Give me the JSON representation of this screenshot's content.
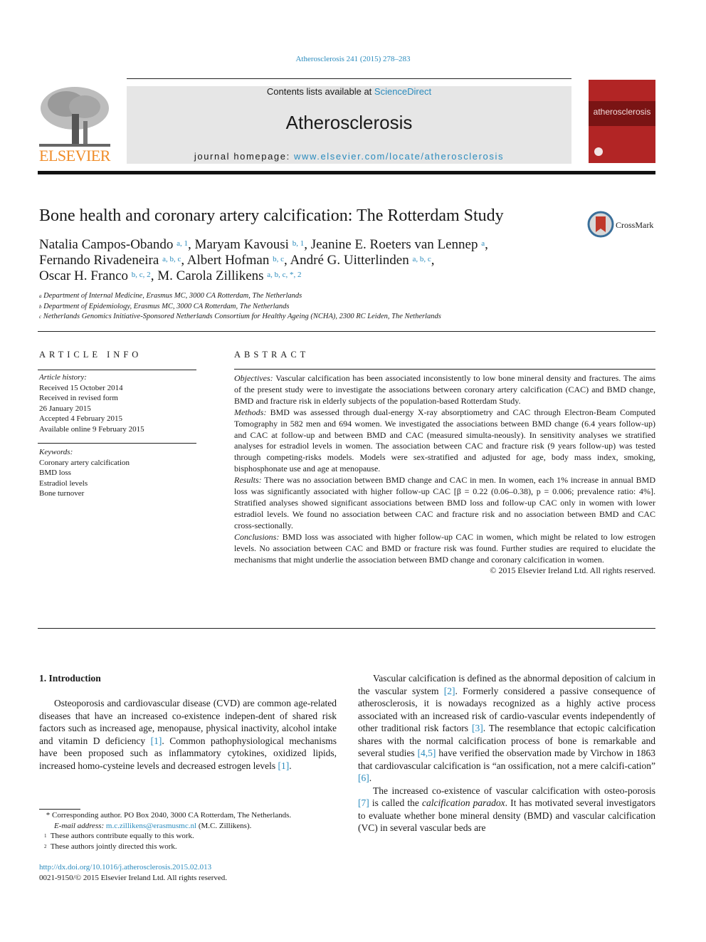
{
  "journal_ref": "Atherosclerosis 241 (2015) 278–283",
  "header": {
    "contents_prefix": "Contents lists available at ",
    "contents_link": "ScienceDirect",
    "journal_title": "Atherosclerosis",
    "homepage_prefix": "journal homepage: ",
    "homepage_link": "www.elsevier.com/locate/atherosclerosis",
    "publisher_logo": "ELSEVIER",
    "cover_title": "atherosclerosis",
    "crossmark": "CrossMark"
  },
  "colors": {
    "link": "#2a8bbd",
    "elsevier_orange": "#f08c28",
    "cover_red": "#b22525"
  },
  "article": {
    "title": "Bone health and coronary artery calcification: The Rotterdam Study",
    "authors": [
      {
        "name": "Natalia Campos-Obando",
        "sup": "a, 1",
        "sep": ", "
      },
      {
        "name": "Maryam Kavousi",
        "sup": "b, 1",
        "sep": ", "
      },
      {
        "name": "Jeanine E. Roeters van Lennep",
        "sup": "a",
        "sep": ","
      },
      {
        "name": "Fernando Rivadeneira",
        "sup": "a, b, c",
        "sep": ", "
      },
      {
        "name": "Albert Hofman",
        "sup": "b, c",
        "sep": ", "
      },
      {
        "name": "André G. Uitterlinden",
        "sup": "a, b, c",
        "sep": ","
      },
      {
        "name": "Oscar H. Franco",
        "sup": "b, c, 2",
        "sep": ", "
      },
      {
        "name": "M. Carola Zillikens",
        "sup": "a, b, c, *, 2",
        "sep": ""
      }
    ],
    "affiliations": [
      {
        "mark": "a",
        "text": "Department of Internal Medicine, Erasmus MC, 3000 CA Rotterdam, The Netherlands"
      },
      {
        "mark": "b",
        "text": "Department of Epidemiology, Erasmus MC, 3000 CA Rotterdam, The Netherlands"
      },
      {
        "mark": "c",
        "text": "Netherlands Genomics Initiative-Sponsored Netherlands Consortium for Healthy Ageing (NCHA), 2300 RC Leiden, The Netherlands"
      }
    ]
  },
  "article_info": {
    "heading": "ARTICLE INFO",
    "history_label": "Article history:",
    "history": [
      "Received 15 October 2014",
      "Received in revised form",
      "26 January 2015",
      "Accepted 4 February 2015",
      "Available online 9 February 2015"
    ],
    "keywords_label": "Keywords:",
    "keywords": [
      "Coronary artery calcification",
      "BMD loss",
      "Estradiol levels",
      "Bone turnover"
    ]
  },
  "abstract": {
    "heading": "ABSTRACT",
    "sections": [
      {
        "label": "Objectives:",
        "text": " Vascular calcification has been associated inconsistently to low bone mineral density and fractures. The aims of the present study were to investigate the associations between coronary artery calcification (CAC) and BMD change, BMD and fracture risk in elderly subjects of the population-based Rotterdam Study."
      },
      {
        "label": "Methods:",
        "text": " BMD was assessed through dual-energy X-ray absorptiometry and CAC through Electron-Beam Computed Tomography in 582 men and 694 women. We investigated the associations between BMD change (6.4 years follow-up) and CAC at follow-up and between BMD and CAC (measured simulta-neously). In sensitivity analyses we stratified analyses for estradiol levels in women. The association between CAC and fracture risk (9 years follow-up) was tested through competing-risks models. Models were sex-stratified and adjusted for age, body mass index, smoking, bisphosphonate use and age at menopause."
      },
      {
        "label": "Results:",
        "text": " There was no association between BMD change and CAC in men. In women, each 1% increase in annual BMD loss was significantly associated with higher follow-up CAC [β = 0.22 (0.06–0.38), p = 0.006; prevalence ratio: 4%]. Stratified analyses showed significant associations between BMD loss and follow-up CAC only in women with lower estradiol levels. We found no association between CAC and fracture risk and no association between BMD and CAC cross-sectionally."
      },
      {
        "label": "Conclusions:",
        "text": " BMD loss was associated with higher follow-up CAC in women, which might be related to low estrogen levels. No association between CAC and BMD or fracture risk was found. Further studies are required to elucidate the mechanisms that might underlie the association between BMD change and coronary calcification in women."
      }
    ],
    "copyright": "© 2015 Elsevier Ireland Ltd. All rights reserved."
  },
  "body": {
    "section_heading": "1.  Introduction",
    "left_para": {
      "t1": "Osteoporosis and cardiovascular disease (CVD) are common age-related diseases that have an increased co-existence indepen-dent of shared risk factors such as increased age, menopause, physical inactivity, alcohol intake and vitamin D deficiency ",
      "r1": "[1]",
      "t2": ". Common pathophysiological mechanisms have been proposed such as inflammatory cytokines, oxidized lipids, increased homo-cysteine levels and decreased estrogen levels ",
      "r2": "[1]",
      "t3": "."
    },
    "right_para1": {
      "t1": "Vascular calcification is defined as the abnormal deposition of calcium in the vascular system ",
      "r1": "[2]",
      "t2": ". Formerly considered a passive consequence of atherosclerosis, it is nowadays recognized as a highly active process associated with an increased risk of cardio-vascular events independently of other traditional risk factors ",
      "r2": "[3]",
      "t3": ". The resemblance that ectopic calcification shares with the normal calcification process of bone is remarkable and several studies ",
      "r3": "[4,5]",
      "t4": " have verified the observation made by Virchow in 1863 that cardiovascular calcification is “an ossification, not a mere calcifi-cation” ",
      "r4": "[6]",
      "t5": "."
    },
    "right_para2": {
      "t1": "The increased co-existence of vascular calcification with osteo-porosis ",
      "r1": "[7]",
      "t2": " is called the ",
      "em": "calcification paradox",
      "t3": ". It has motivated several investigators to evaluate whether bone mineral density (BMD) and vascular calcification (VC) in several vascular beds are"
    }
  },
  "footnotes": {
    "corresponding": "Corresponding author. PO Box 2040, 3000 CA Rotterdam, The Netherlands.",
    "email_label": "E-mail address: ",
    "email": "m.c.zillikens@erasmusmc.nl",
    "email_suffix": " (M.C. Zillikens).",
    "fn1": "These authors contribute equally to this work.",
    "fn2": "These authors jointly directed this work.",
    "doi": "http://dx.doi.org/10.1016/j.atherosclerosis.2015.02.013",
    "issn": "0021-9150/© 2015 Elsevier Ireland Ltd. All rights reserved."
  }
}
